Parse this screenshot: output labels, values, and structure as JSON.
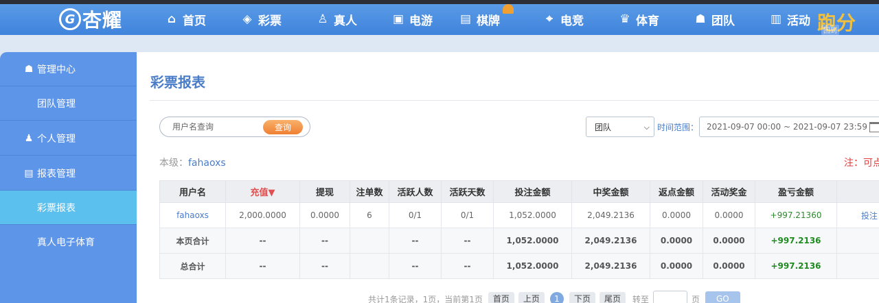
{
  "brand": {
    "logo_text": "杏耀"
  },
  "nav": {
    "items": [
      {
        "label": "首页",
        "icon": "home-icon",
        "glyph": "⌂"
      },
      {
        "label": "彩票",
        "icon": "ticket-icon",
        "glyph": "◈"
      },
      {
        "label": "真人",
        "icon": "person-icon",
        "glyph": "♙"
      },
      {
        "label": "电游",
        "icon": "slot-machine-icon",
        "glyph": "▣"
      },
      {
        "label": "棋牌",
        "icon": "cards-icon",
        "glyph": "▤"
      },
      {
        "label": "电竞",
        "icon": "gamepad-icon",
        "glyph": "⌖"
      },
      {
        "label": "体育",
        "icon": "trophy-icon",
        "glyph": "♛"
      },
      {
        "label": "团队",
        "icon": "team-icon",
        "glyph": "☗"
      },
      {
        "label": "活动",
        "icon": "gift-icon",
        "glyph": "▥"
      }
    ],
    "right_text": "跑分",
    "right_small": "回到"
  },
  "sidebar": {
    "items": [
      {
        "label": "管理中心",
        "icon": "users-icon",
        "glyph": "☗",
        "indent": false
      },
      {
        "label": "团队管理",
        "icon": "",
        "glyph": "",
        "indent": true
      },
      {
        "label": "个人管理",
        "icon": "user-icon",
        "glyph": "♟",
        "indent": false
      },
      {
        "label": "报表管理",
        "icon": "report-icon",
        "glyph": "▤",
        "indent": false
      },
      {
        "label": "彩票报表",
        "icon": "",
        "glyph": "",
        "indent": true,
        "active": true
      },
      {
        "label": "真人电子体育",
        "icon": "",
        "glyph": "",
        "indent": true
      }
    ]
  },
  "main": {
    "title": "彩票报表",
    "search": {
      "placeholder": "用户名查询",
      "button": "查询"
    },
    "filter": {
      "select_value": "团队",
      "time_label": "时间范围：",
      "date_range": "2021-09-07 00:00 ~ 2021-09-07 23:59"
    },
    "level": {
      "label": "本级：",
      "username": "fahaoxs"
    },
    "note": "注：可点"
  },
  "table": {
    "headers": [
      "用户名",
      "充值▼",
      "提现",
      "注单数",
      "活跃人数",
      "活跃天数",
      "投注金额",
      "中奖金额",
      "返点金额",
      "活动奖金",
      "盈亏金额",
      ""
    ],
    "rows": [
      [
        "fahaoxs",
        "2,000.0000",
        "0.0000",
        "6",
        "0/1",
        "0/1",
        "1,052.0000",
        "2,049.2136",
        "0.0000",
        "0.0000",
        "+997.21360",
        "投注"
      ],
      [
        "本页合计",
        "--",
        "--",
        "",
        "--",
        "--",
        "1,052.0000",
        "2,049.2136",
        "0.0000",
        "0.0000",
        "+997.2136",
        ""
      ],
      [
        "总合计",
        "--",
        "--",
        "",
        "--",
        "--",
        "1,052.0000",
        "2,049.2136",
        "0.0000",
        "0.0000",
        "+997.2136",
        ""
      ]
    ]
  },
  "pager": {
    "summary": "共计1条记录，1页，当前第1页",
    "first": "首页",
    "prev": "上页",
    "current": "1",
    "next": "下页",
    "last": "尾页",
    "goto_label": "转至",
    "page_unit": "页",
    "go": "GO"
  }
}
